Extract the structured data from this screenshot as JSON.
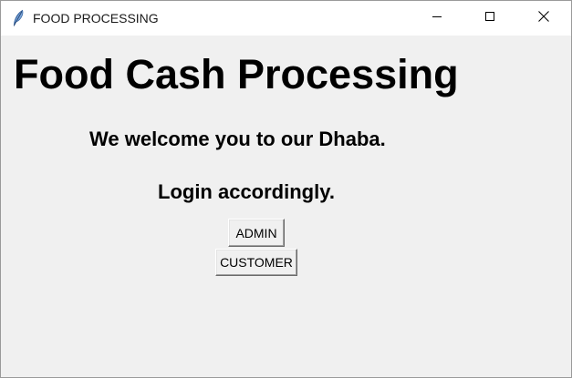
{
  "window": {
    "title": "FOOD PROCESSING",
    "app_icon": "feather-icon",
    "controls": {
      "minimize_icon": "minimize-icon",
      "maximize_icon": "maximize-icon",
      "close_icon": "close-icon"
    }
  },
  "main": {
    "heading": "Food Cash Processing",
    "welcome": "We welcome you to our Dhaba.",
    "login_prompt": "Login accordingly.",
    "buttons": {
      "admin": "ADMIN",
      "customer": "CUSTOMER"
    }
  },
  "colors": {
    "background": "#f0f0f0",
    "titlebar": "#ffffff",
    "text": "#000000"
  }
}
